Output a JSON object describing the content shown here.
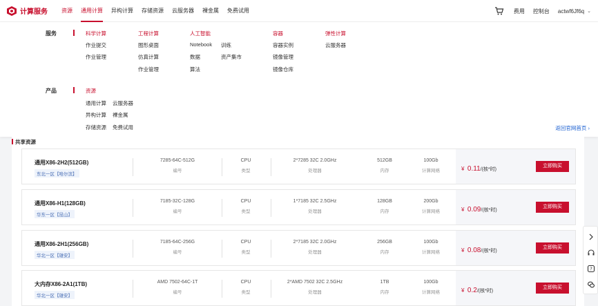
{
  "header": {
    "logo_text": "计算服务",
    "nav": [
      {
        "label": "资源"
      },
      {
        "label": "通用计算"
      },
      {
        "label": "异构计算"
      },
      {
        "label": "存储资源"
      },
      {
        "label": "云服务器"
      },
      {
        "label": "裸金属"
      },
      {
        "label": "免费试用"
      }
    ],
    "fee": "费用",
    "console": "控制台",
    "username": "actwf6Jf6q"
  },
  "mega": {
    "service_label": "服务",
    "product_label": "产品",
    "columns": [
      {
        "title": "科学计算",
        "items": [
          "作业提交",
          "作业管理"
        ]
      },
      {
        "title": "工程计算",
        "items": [
          "图形桌面",
          "仿真计算",
          "作业管理"
        ]
      },
      {
        "title": "人工智能",
        "items": [
          "Notebook",
          "训练",
          "数据",
          "资产集市",
          "算法"
        ]
      },
      {
        "title": "容器",
        "items": [
          "容器实例",
          "镜像管理",
          "镜像仓库"
        ]
      },
      {
        "title": "弹性计算",
        "items": [
          "云服务器"
        ]
      }
    ],
    "product_title": "资源",
    "product_items": [
      "通用计算",
      "云服务器",
      "异构计算",
      "裸金属",
      "存储资源",
      "免费试用"
    ],
    "back_link": "返回官网首页"
  },
  "shared_title": "共享资源",
  "cards": [
    {
      "name": "通用X86-2H2(512GB)",
      "region": "东北一区【哈尔滨】",
      "code": "7285-64C-512G",
      "code_label": "编号",
      "type": "CPU",
      "type_label": "类型",
      "cpu": "2*7285 32C 2.0GHz",
      "cpu_label": "处理器",
      "mem": "512GB",
      "mem_label": "内存",
      "net": "100Gb",
      "net_label": "计算网络",
      "yen": "¥",
      "price": "0.11",
      "unit": "/(核*时)",
      "buy": "立即购买"
    },
    {
      "name": "通用X86-H1(128GB)",
      "region": "华东一区【昆山】",
      "code": "7185-32C-128G",
      "code_label": "编号",
      "type": "CPU",
      "type_label": "类型",
      "cpu": "1*7185 32C 2.5GHz",
      "cpu_label": "处理器",
      "mem": "128GB",
      "mem_label": "内存",
      "net": "200Gb",
      "net_label": "计算网络",
      "yen": "¥",
      "price": "0.09",
      "unit": "/(核*时)",
      "buy": "立即购买"
    },
    {
      "name": "通用X86-2H1(256GB)",
      "region": "华北一区【雄安】",
      "code": "7185-64C-256G",
      "code_label": "编号",
      "type": "CPU",
      "type_label": "类型",
      "cpu": "2*7185 32C 2.0GHz",
      "cpu_label": "处理器",
      "mem": "256GB",
      "mem_label": "内存",
      "net": "100Gb",
      "net_label": "计算网络",
      "yen": "¥",
      "price": "0.08",
      "unit": "/(核*时)",
      "buy": "立即购买"
    },
    {
      "name": "大内存X86-2A1(1TB)",
      "region": "华北一区【雄安】",
      "code": "AMD 7502-64C-1T",
      "code_label": "编号",
      "type": "CPU",
      "type_label": "类型",
      "cpu": "2*AMD 7502 32C 2.5GHz",
      "cpu_label": "处理器",
      "mem": "1TB",
      "mem_label": "内存",
      "net": "100Gb",
      "net_label": "计算网络",
      "yen": "¥",
      "price": "0.2",
      "unit": "/(核*时)",
      "buy": "立即购买"
    }
  ],
  "colors": {
    "brand": "#c8102e",
    "link": "#1a5fd1"
  },
  "icons": {
    "cart": "cart-icon",
    "sidebar": [
      "chevron-right-icon",
      "headset-icon",
      "help-icon",
      "chat-icon"
    ]
  }
}
